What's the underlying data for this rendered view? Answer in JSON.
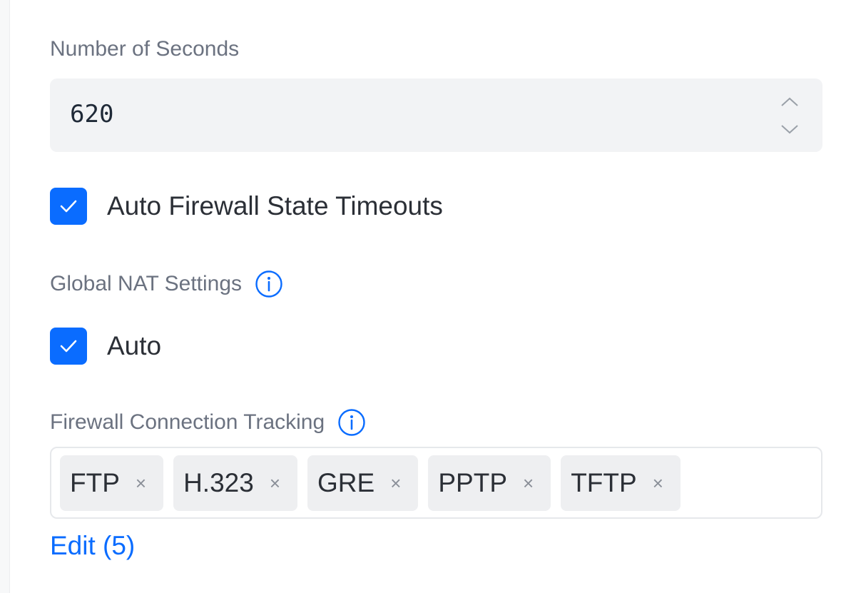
{
  "timeout": {
    "label": "Number of Seconds",
    "value": "620"
  },
  "auto_firewall_state": {
    "label": "Auto Firewall State Timeouts",
    "checked": true
  },
  "global_nat": {
    "label": "Global NAT Settings",
    "auto_label": "Auto",
    "auto_checked": true
  },
  "connection_tracking": {
    "label": "Firewall Connection Tracking",
    "tags": [
      {
        "label": "FTP",
        "remove": "×"
      },
      {
        "label": "H.323",
        "remove": "×"
      },
      {
        "label": "GRE",
        "remove": "×"
      },
      {
        "label": "PPTP",
        "remove": "×"
      },
      {
        "label": "TFTP",
        "remove": "×"
      }
    ],
    "edit_label": "Edit (5)"
  },
  "colors": {
    "accent": "#0a6cff",
    "label_text": "#6b7280",
    "body_text": "#2b2f36",
    "input_bg": "#f2f3f5",
    "tag_bg": "#eeeff1"
  },
  "icons": {
    "info": "info-circle-icon",
    "check": "checkmark-icon",
    "stepper_up": "chevron-up-icon",
    "stepper_down": "chevron-down-icon",
    "remove": "close-icon"
  }
}
